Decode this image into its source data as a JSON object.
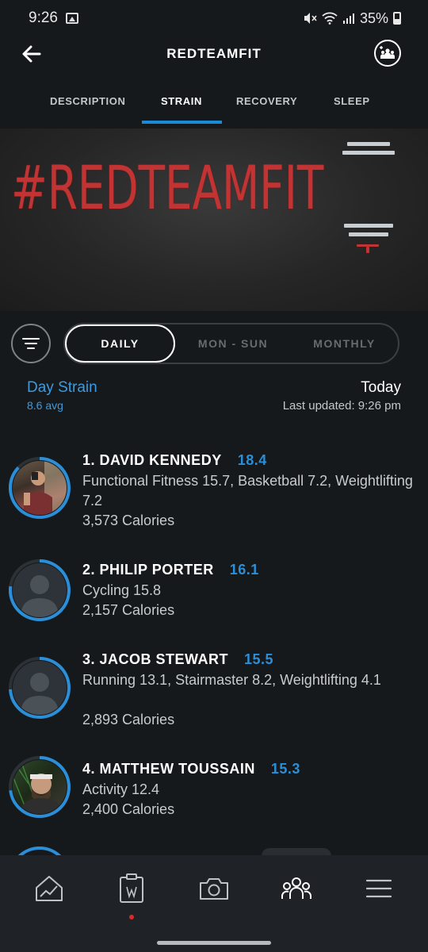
{
  "status_bar": {
    "time": "9:26",
    "battery": "35%"
  },
  "header": {
    "title": "REDTEAMFIT"
  },
  "tabs": [
    {
      "label": "DESCRIPTION"
    },
    {
      "label": "STRAIN"
    },
    {
      "label": "RECOVERY"
    },
    {
      "label": "SLEEP"
    }
  ],
  "banner": {
    "text": "#REDTEAMFIT"
  },
  "segment": {
    "options": [
      "DAILY",
      "MON - SUN",
      "MONTHLY"
    ],
    "selected": "DAILY"
  },
  "stats": {
    "metric_label": "Day Strain",
    "average": "8.6 avg",
    "period": "Today",
    "last_updated": "Last updated: 9:26 pm"
  },
  "leaderboard": [
    {
      "rank_name": "1. DAVID KENNEDY",
      "score": "18.4",
      "activities": "Functional Fitness 15.7, Basketball 7.2, Weightlifting 7.2",
      "calories": "3,573 Calories",
      "progress": 0.87
    },
    {
      "rank_name": "2. PHILIP PORTER",
      "score": "16.1",
      "activities": "Cycling 15.8",
      "calories": "2,157 Calories",
      "progress": 0.77
    },
    {
      "rank_name": "3. JACOB STEWART",
      "score": "15.5",
      "activities": "Running 13.1, Stairmaster 8.2, Weightlifting 4.1",
      "calories": "2,893 Calories",
      "progress": 0.74
    },
    {
      "rank_name": "4. MATTHEW TOUSSAIN",
      "score": "15.3",
      "activities": "Activity 12.4",
      "calories": "2,400 Calories",
      "progress": 0.73
    }
  ],
  "nav": {
    "items": [
      "overview-icon",
      "journal-icon",
      "camera-icon",
      "community-icon",
      "menu-icon"
    ],
    "active": "community-icon",
    "accent": "#1a89d6"
  }
}
